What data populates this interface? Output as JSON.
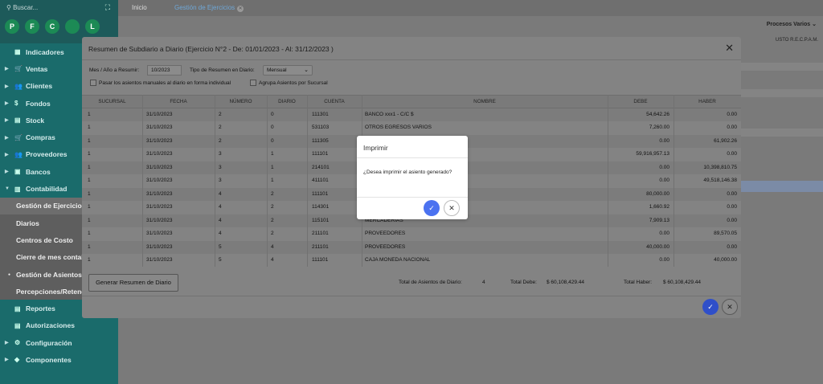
{
  "sidebar": {
    "search_placeholder": "Buscar...",
    "shortcuts": [
      "P",
      "F",
      "C",
      "",
      "L"
    ],
    "menu_top": [
      {
        "label": "Indicadores",
        "icon": "▦",
        "caret": ""
      },
      {
        "label": "Ventas",
        "icon": "🛒",
        "caret": "▶"
      },
      {
        "label": "Clientes",
        "icon": "👥",
        "caret": "▶"
      },
      {
        "label": "Fondos",
        "icon": "$",
        "caret": "▶"
      },
      {
        "label": "Stock",
        "icon": "▤",
        "caret": "▶"
      },
      {
        "label": "Compras",
        "icon": "🛒",
        "caret": "▶"
      },
      {
        "label": "Proveedores",
        "icon": "👥",
        "caret": "▶"
      },
      {
        "label": "Bancos",
        "icon": "▣",
        "caret": "▶"
      },
      {
        "label": "Contabilidad",
        "icon": "▥",
        "caret": "▼"
      }
    ],
    "submenu": [
      {
        "label": "Gestión de Ejercicios",
        "bullet": ""
      },
      {
        "label": "Diarios",
        "bullet": ""
      },
      {
        "label": "Centros de Costo",
        "bullet": ""
      },
      {
        "label": "Cierre de mes contable",
        "bullet": ""
      },
      {
        "label": "Gestión de Asientos",
        "bullet": "●"
      },
      {
        "label": "Percepciones/Retenciones",
        "bullet": ""
      }
    ],
    "menu_bottom": [
      {
        "label": "Reportes",
        "icon": "▤",
        "caret": ""
      },
      {
        "label": "Autorizaciones",
        "icon": "▤",
        "caret": ""
      },
      {
        "label": "Configuración",
        "icon": "⚙",
        "caret": "▶"
      },
      {
        "label": "Componentes",
        "icon": "◆",
        "caret": "▶"
      }
    ]
  },
  "topbar": {
    "tab_home": "Inicio",
    "tab_active": "Gestión de Ejercicios",
    "procesos": "Procesos Varios",
    "recpam": "USTO R.E.C.P.A.M."
  },
  "modal": {
    "title": "Resumen de Subdiario a Diario (Ejercicio N°2 - De: 01/01/2023 - Al: 31/12/2023 )",
    "mes_label": "Mes / Año a Resumir:",
    "mes_value": "10/2023",
    "tipo_label": "Tipo de Resumen en Diario:",
    "tipo_value": "Mensual",
    "chk1_label": "Pasar los asientos manuales al diario en forma individual",
    "chk2_label": "Agrupa Asientos por Sucursal",
    "columns": [
      "SUCURSAL",
      "FECHA",
      "NÚMERO",
      "DIARIO",
      "CUENTA",
      "NOMBRE",
      "DEBE",
      "HABER"
    ],
    "rows": [
      [
        "1",
        "31/10/2023",
        "2",
        "0",
        "111301",
        "BANCO xxx1 - C/C $",
        "54,642.26",
        "0.00"
      ],
      [
        "1",
        "31/10/2023",
        "2",
        "0",
        "531103",
        "OTROS EGRESOS VARIOS",
        "7,260.00",
        "0.00"
      ],
      [
        "1",
        "31/10/2023",
        "2",
        "0",
        "111305",
        "CIONES",
        "0.00",
        "61,902.26"
      ],
      [
        "1",
        "31/10/2023",
        "3",
        "1",
        "111101",
        "",
        "59,916,957.13",
        "0.00"
      ],
      [
        "1",
        "31/10/2023",
        "3",
        "1",
        "214101",
        "",
        "0.00",
        "10,398,810.75"
      ],
      [
        "1",
        "31/10/2023",
        "3",
        "1",
        "411101",
        "",
        "0.00",
        "49,518,146.38"
      ],
      [
        "1",
        "31/10/2023",
        "4",
        "2",
        "111101",
        "",
        "80,000.00",
        "0.00"
      ],
      [
        "1",
        "31/10/2023",
        "4",
        "2",
        "114301",
        "",
        "1,660.92",
        "0.00"
      ],
      [
        "1",
        "31/10/2023",
        "4",
        "2",
        "115101",
        "MERCADERIAS",
        "7,909.13",
        "0.00"
      ],
      [
        "1",
        "31/10/2023",
        "4",
        "2",
        "211101",
        "PROVEEDORES",
        "0.00",
        "89,570.05"
      ],
      [
        "1",
        "31/10/2023",
        "5",
        "4",
        "211101",
        "PROVEEDORES",
        "40,000.00",
        "0.00"
      ],
      [
        "1",
        "31/10/2023",
        "5",
        "4",
        "111101",
        "CAJA MONEDA NACIONAL",
        "0.00",
        "40,000.00"
      ]
    ],
    "generate_label": "Generar Resumen de Diario",
    "total_asientos_label": "Total de Asientos de Diario:",
    "total_asientos_value": "4",
    "total_debe_label": "Total Debe:",
    "total_debe_value": "$ 60,108,429.44",
    "total_haber_label": "Total Haber:",
    "total_haber_value": "$ 60,108,429.44"
  },
  "dialog": {
    "title": "Imprimir",
    "message": "¿Desea imprimir el asiento generado?"
  },
  "colors": {
    "sidebar": "#1a6b6b",
    "accent_blue": "#4b72f0",
    "shortcut_green": "#1c8a55"
  }
}
